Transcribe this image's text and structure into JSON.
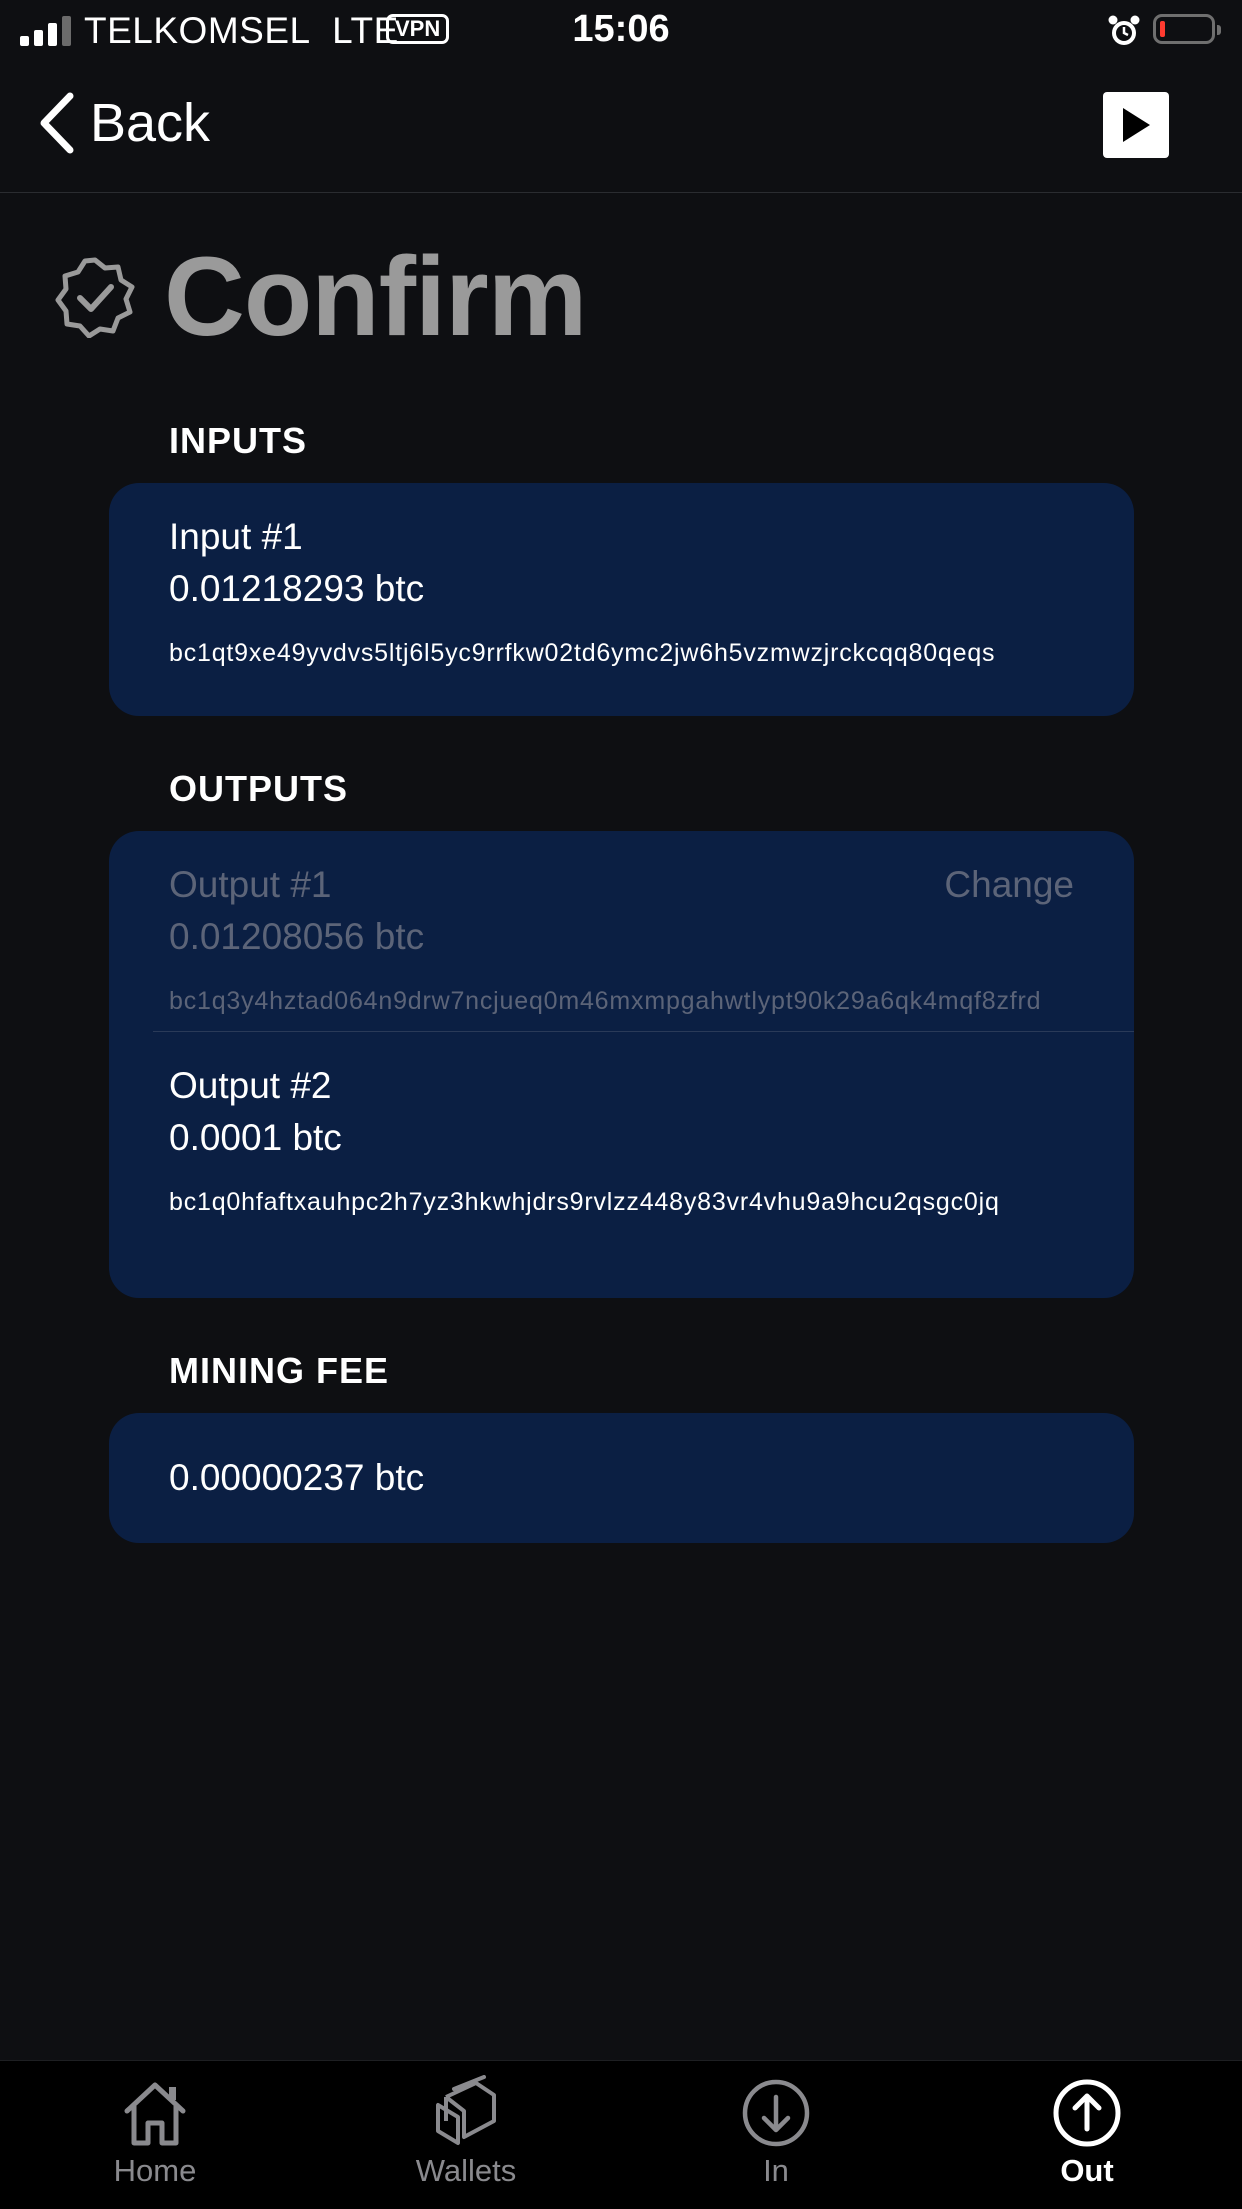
{
  "status_bar": {
    "carrier": "TELKOMSEL",
    "network": "LTE",
    "vpn": "VPN",
    "time": "15:06",
    "battery_level": 0.1
  },
  "nav": {
    "back_label": "Back"
  },
  "page": {
    "title": "Confirm"
  },
  "inputs": {
    "header": "INPUTS",
    "items": [
      {
        "label": "Input #1",
        "amount": "0.01218293 btc",
        "address": "bc1qt9xe49yvdvs5ltj6l5yc9rrfkw02td6ymc2jw6h5vzmwzjrckcqq80qeqs"
      }
    ]
  },
  "outputs": {
    "header": "OUTPUTS",
    "items": [
      {
        "label": "Output #1",
        "tag": "Change",
        "amount": "0.01208056 btc",
        "address": "bc1q3y4hztad064n9drw7ncjueq0m46mxmpgahwtlypt90k29a6qk4mqf8zfrd"
      },
      {
        "label": "Output #2",
        "amount": "0.0001 btc",
        "address": "bc1q0hfaftxauhpc2h7yz3hkwhjdrs9rvlzz448y83vr4vhu9a9hcu2qsgc0jq"
      }
    ]
  },
  "fee": {
    "header": "MINING FEE",
    "amount": "0.00000237 btc"
  },
  "tab_bar": {
    "tabs": [
      {
        "label": "Home",
        "icon": "home-icon"
      },
      {
        "label": "Wallets",
        "icon": "wallets-icon"
      },
      {
        "label": "In",
        "icon": "arrow-down-circle-icon"
      },
      {
        "label": "Out",
        "icon": "arrow-up-circle-icon",
        "active": true
      }
    ]
  },
  "colors": {
    "background": "#0e0f12",
    "card": "#0b1f43",
    "title": "#9a9a9a",
    "muted_text": "#5c6478",
    "battery_low": "#ff3b30"
  }
}
